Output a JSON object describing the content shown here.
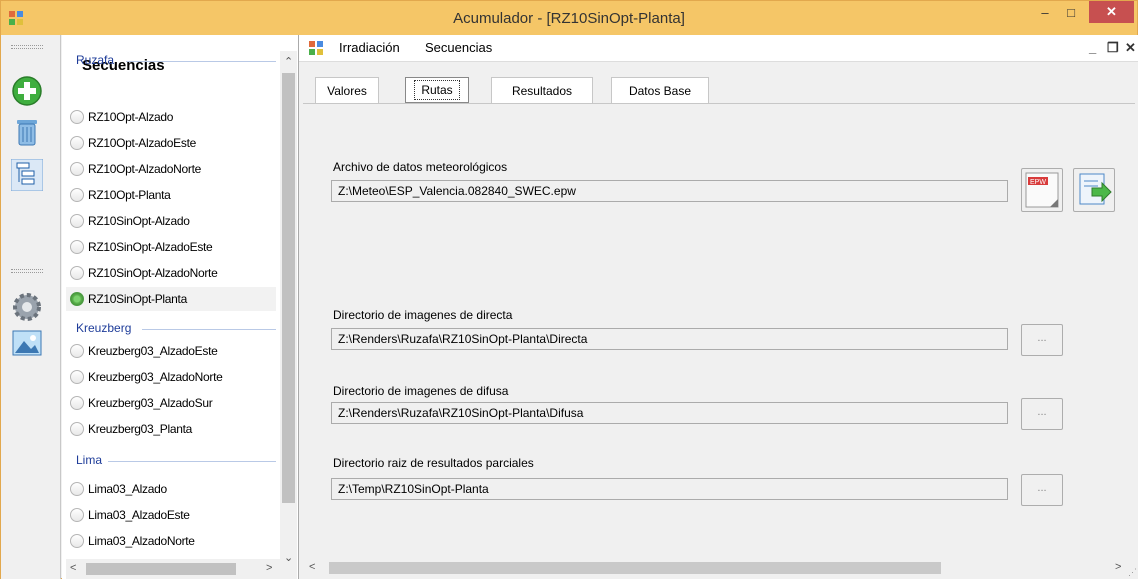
{
  "window": {
    "title": "Acumulador - [RZ10SinOpt-Planta]"
  },
  "sidebar": {
    "title": "Secuencias"
  },
  "groups": [
    {
      "name": "Ruzafa",
      "items": [
        "RZ10Opt-Alzado",
        "RZ10Opt-AlzadoEste",
        "RZ10Opt-AlzadoNorte",
        "RZ10Opt-Planta",
        "RZ10SinOpt-Alzado",
        "RZ10SinOpt-AlzadoEste",
        "RZ10SinOpt-AlzadoNorte",
        "RZ10SinOpt-Planta"
      ]
    },
    {
      "name": "Kreuzberg",
      "items": [
        "Kreuzberg03_AlzadoEste",
        "Kreuzberg03_AlzadoNorte",
        "Kreuzberg03_AlzadoSur",
        "Kreuzberg03_Planta"
      ]
    },
    {
      "name": "Lima",
      "items": [
        "Lima03_Alzado",
        "Lima03_AlzadoEste",
        "Lima03_AlzadoNorte"
      ]
    }
  ],
  "selected_item": "RZ10SinOpt-Planta",
  "menu": {
    "items": [
      "Irradiación",
      "Secuencias"
    ]
  },
  "tabs": [
    {
      "label": "Valores"
    },
    {
      "label": "Rutas",
      "active": true
    },
    {
      "label": "Resultados"
    },
    {
      "label": "Datos Base"
    }
  ],
  "form": {
    "meteo_label": "Archivo de datos meteorológicos",
    "meteo_value": "Z:\\Meteo\\ESP_Valencia.082840_SWEC.epw",
    "directa_label": "Directorio de imagenes de directa",
    "directa_value": "Z:\\Renders\\Ruzafa\\RZ10SinOpt-Planta\\Directa",
    "difusa_label": "Directorio de imagenes de difusa",
    "difusa_value": "Z:\\Renders\\Ruzafa\\RZ10SinOpt-Planta\\Difusa",
    "parciales_label": "Directorio raiz de resultados parciales",
    "parciales_value": "Z:\\Temp\\RZ10SinOpt-Planta",
    "browse_label": "...",
    "epw_badge": "EPW"
  },
  "colors": {
    "titlebar": "#f5c667",
    "close": "#c75050",
    "group_text": "#1e3c99",
    "selected_radio": "#5db34f"
  },
  "icons": [
    "add-icon",
    "trash-icon",
    "tree-icon",
    "gear-icon",
    "image-icon",
    "epw-file-icon",
    "export-arrow-icon"
  ]
}
